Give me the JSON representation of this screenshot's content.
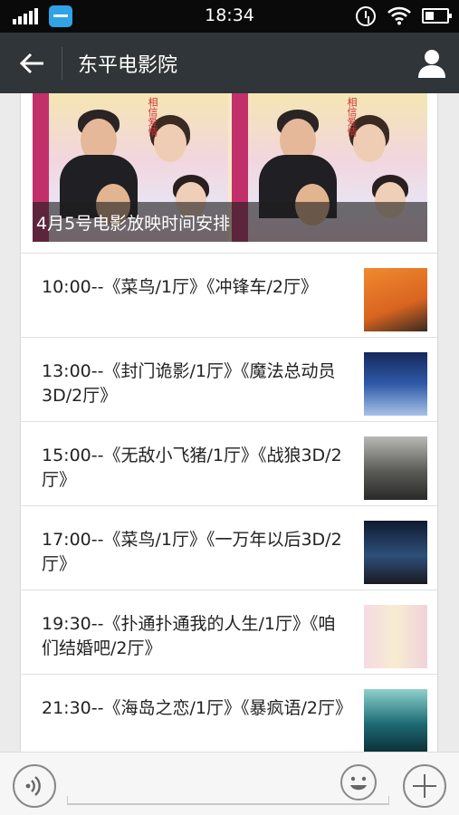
{
  "status_bar": {
    "time": "18:34",
    "icons": [
      "signal-icon",
      "app-notification-icon",
      "alarm-icon",
      "wifi-icon",
      "battery-icon"
    ]
  },
  "header": {
    "title": "东平电影院",
    "back_icon": "arrow-left-icon",
    "profile_icon": "person-icon"
  },
  "article": {
    "cover_caption": "4月5号电影放映时间安排",
    "items": [
      {
        "text": "10:00--《菜鸟/1厅》《冲锋车/2厅》",
        "thumb_colors": [
          "#e0782a",
          "#3a2a20"
        ]
      },
      {
        "text": "13:00--《封门诡影/1厅》《魔法总动员3D/2厅》",
        "thumb_colors": [
          "#1f3a7a",
          "#6a9ad8"
        ]
      },
      {
        "text": "15:00--《无敌小飞猪/1厅》《战狼3D/2厅》",
        "thumb_colors": [
          "#4a4a48",
          "#8a8a86"
        ]
      },
      {
        "text": "17:00--《菜鸟/1厅》《一万年以后3D/2厅》",
        "thumb_colors": [
          "#1c2a4a",
          "#3f5f8a"
        ]
      },
      {
        "text": "19:30--《扑通扑通我的人生/1厅》《咱们结婚吧/2厅》",
        "thumb_colors": [
          "#f3d6de",
          "#f5e7c0"
        ]
      },
      {
        "text": "21:30--《海岛之恋/1厅》《暴疯语/2厅》",
        "thumb_colors": [
          "#1d6b74",
          "#7fc4c0"
        ]
      }
    ]
  },
  "bottom_bar": {
    "voice_icon": "voice-icon",
    "emoji_icon": "emoji-icon",
    "more_icon": "plus-icon"
  },
  "colors": {
    "status_bar_bg": "#0a0a0a",
    "title_bar_bg": "#2f3539",
    "page_bg": "#ebebeb"
  }
}
